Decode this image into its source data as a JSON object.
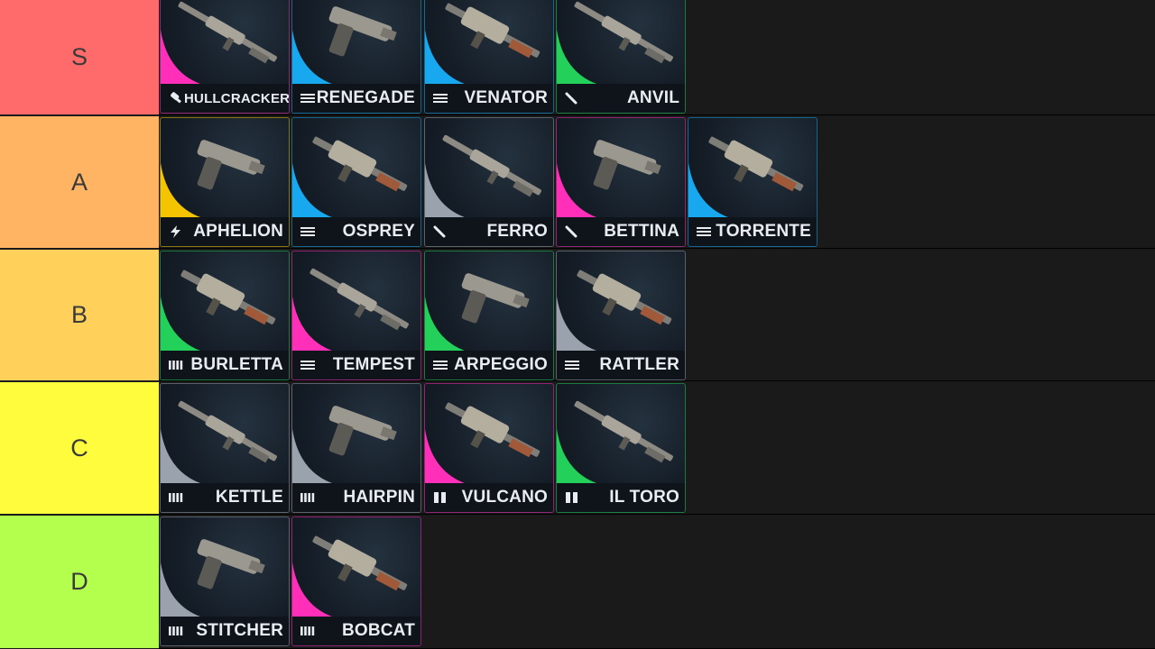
{
  "tiers": [
    {
      "label": "S",
      "color": "#ff6b6b",
      "weapons": [
        {
          "name": "HULLCRACKER",
          "rarity": "#ff2fb9",
          "ammo": "launcher-ammo-icon"
        },
        {
          "name": "RENEGADE",
          "rarity": "#17a8f0",
          "ammo": "medium-ammo-icon"
        },
        {
          "name": "VENATOR",
          "rarity": "#17a8f0",
          "ammo": "medium-ammo-icon"
        },
        {
          "name": "ANVIL",
          "rarity": "#22d05a",
          "ammo": "heavy-ammo-icon"
        }
      ]
    },
    {
      "label": "A",
      "color": "#ffb463",
      "weapons": [
        {
          "name": "APHELION",
          "rarity": "#f5c400",
          "ammo": "energy-ammo-icon"
        },
        {
          "name": "OSPREY",
          "rarity": "#17a8f0",
          "ammo": "medium-ammo-icon"
        },
        {
          "name": "FERRO",
          "rarity": "#9aa2ad",
          "ammo": "heavy-ammo-icon"
        },
        {
          "name": "BETTINA",
          "rarity": "#ff2fb9",
          "ammo": "heavy-ammo-icon"
        },
        {
          "name": "TORRENTE",
          "rarity": "#17a8f0",
          "ammo": "medium-ammo-icon"
        }
      ]
    },
    {
      "label": "B",
      "color": "#ffd15a",
      "weapons": [
        {
          "name": "BURLETTA",
          "rarity": "#22d05a",
          "ammo": "light-ammo-icon"
        },
        {
          "name": "TEMPEST",
          "rarity": "#ff2fb9",
          "ammo": "medium-ammo-icon"
        },
        {
          "name": "ARPEGGIO",
          "rarity": "#22d05a",
          "ammo": "medium-ammo-icon"
        },
        {
          "name": "RATTLER",
          "rarity": "#9aa2ad",
          "ammo": "medium-ammo-icon"
        }
      ]
    },
    {
      "label": "C",
      "color": "#fffb3d",
      "weapons": [
        {
          "name": "KETTLE",
          "rarity": "#9aa2ad",
          "ammo": "light-ammo-icon"
        },
        {
          "name": "HAIRPIN",
          "rarity": "#9aa2ad",
          "ammo": "light-ammo-icon"
        },
        {
          "name": "VULCANO",
          "rarity": "#ff2fb9",
          "ammo": "shotgun-ammo-icon"
        },
        {
          "name": "IL TORO",
          "rarity": "#22d05a",
          "ammo": "shotgun-ammo-icon"
        }
      ]
    },
    {
      "label": "D",
      "color": "#b4ff4e",
      "weapons": [
        {
          "name": "STITCHER",
          "rarity": "#9aa2ad",
          "ammo": "light-ammo-icon"
        },
        {
          "name": "BOBCAT",
          "rarity": "#ff2fb9",
          "ammo": "light-ammo-icon"
        }
      ]
    }
  ]
}
